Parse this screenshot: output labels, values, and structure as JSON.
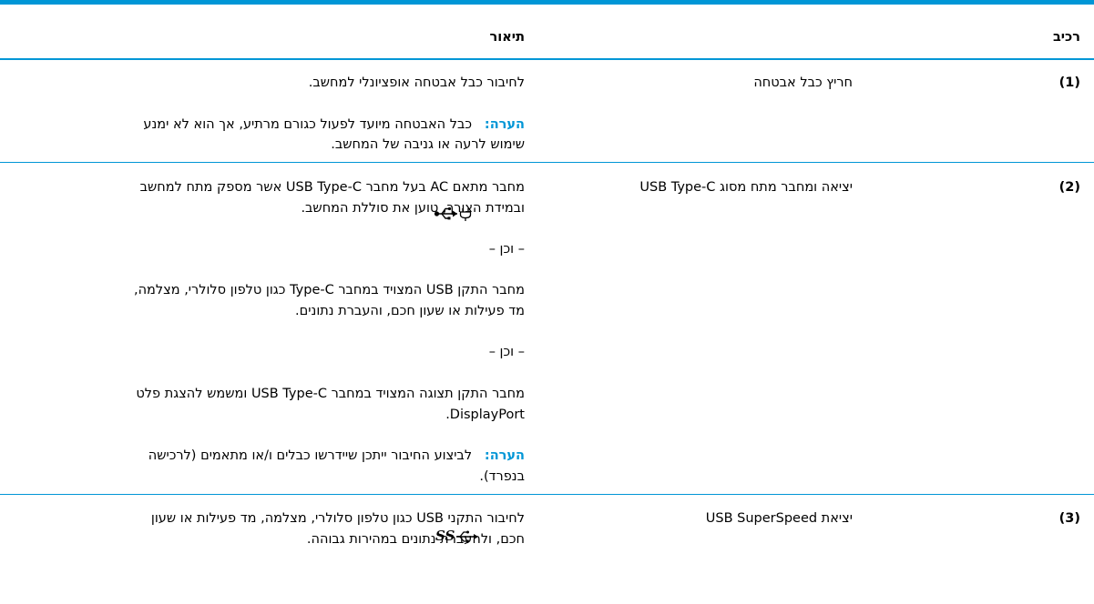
{
  "header": {
    "component": "רכיב",
    "description": "תיאור"
  },
  "rows": [
    {
      "num": "(1)",
      "name": "חריץ כבל אבטחה",
      "desc": [
        "לחיבור כבל אבטחה אופציונלי למחשב."
      ],
      "note": {
        "label": "הערה:",
        "line1": "כבל האבטחה מיועד לפעול כגורם מרתיע, אך הוא לא ימנע",
        "line2": "שימוש לרעה או גניבה של המחשב."
      }
    },
    {
      "num": "(2)",
      "icon": "usb-power-delivery-icon",
      "name": "יציאה ומחבר מתח מסוג USB Type-C",
      "desc": [
        "מחבר מתאם AC בעל מחבר USB Type-C אשר מספק מתח למחשב",
        "ובמידת הצורך, טוען את סוללת המחשב.",
        "– וכן –",
        "מחבר התקן USB המצויד במחבר Type-C כגון טלפון סלולרי, מצלמה,",
        "מד פעילות או שעון חכם, והעברת נתונים.",
        "– וכן –",
        "מחבר התקן תצוגה המצויד במחבר USB Type-C ומשמש להצגת פלט",
        "DisplayPort."
      ],
      "note": {
        "label": "הערה:",
        "line1": "לביצוע החיבור ייתכן שיידרשו כבלים ו/או מתאמים (לרכישה",
        "line2": "בנפרד)."
      }
    },
    {
      "num": "(3)",
      "icon": "usb-superspeed-icon",
      "icon_text": "SS",
      "name": "יציאת USB SuperSpeed",
      "desc": [
        "לחיבור התקני USB כגון טלפון סלולרי, מצלמה, מד פעילות או שעון",
        "חכם, ולהעברת נתונים במהירות גבוהה."
      ]
    }
  ]
}
